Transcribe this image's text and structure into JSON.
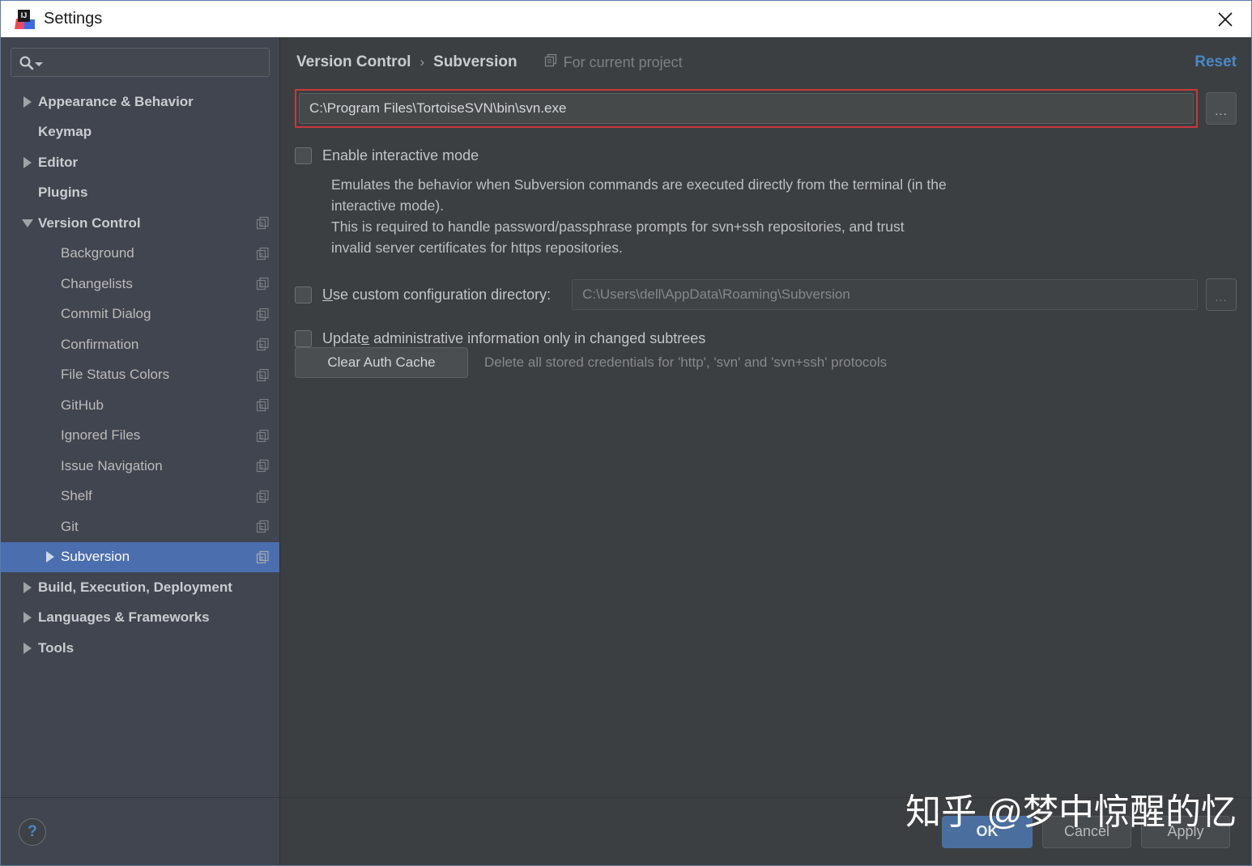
{
  "titlebar": {
    "title": "Settings",
    "app_icon": "intellij-idea-icon",
    "close_icon": "close-icon"
  },
  "sidebar": {
    "search": {
      "placeholder": "",
      "value": "",
      "icon": "search-icon",
      "caret_icon": "chevron-down-icon"
    },
    "help_label": "?",
    "items": [
      {
        "label": "Appearance & Behavior",
        "level": 0,
        "twisty": "right",
        "project_icon": false,
        "selected": false
      },
      {
        "label": "Keymap",
        "level": 0,
        "twisty": "none",
        "project_icon": false,
        "selected": false
      },
      {
        "label": "Editor",
        "level": 0,
        "twisty": "right",
        "project_icon": false,
        "selected": false
      },
      {
        "label": "Plugins",
        "level": 0,
        "twisty": "none",
        "project_icon": false,
        "selected": false
      },
      {
        "label": "Version Control",
        "level": 0,
        "twisty": "down",
        "project_icon": true,
        "selected": false
      },
      {
        "label": "Background",
        "level": 1,
        "twisty": "none",
        "project_icon": true,
        "selected": false
      },
      {
        "label": "Changelists",
        "level": 1,
        "twisty": "none",
        "project_icon": true,
        "selected": false
      },
      {
        "label": "Commit Dialog",
        "level": 1,
        "twisty": "none",
        "project_icon": true,
        "selected": false
      },
      {
        "label": "Confirmation",
        "level": 1,
        "twisty": "none",
        "project_icon": true,
        "selected": false
      },
      {
        "label": "File Status Colors",
        "level": 1,
        "twisty": "none",
        "project_icon": true,
        "selected": false
      },
      {
        "label": "GitHub",
        "level": 1,
        "twisty": "none",
        "project_icon": true,
        "selected": false
      },
      {
        "label": "Ignored Files",
        "level": 1,
        "twisty": "none",
        "project_icon": true,
        "selected": false
      },
      {
        "label": "Issue Navigation",
        "level": 1,
        "twisty": "none",
        "project_icon": true,
        "selected": false
      },
      {
        "label": "Shelf",
        "level": 1,
        "twisty": "none",
        "project_icon": true,
        "selected": false
      },
      {
        "label": "Git",
        "level": 1,
        "twisty": "none",
        "project_icon": true,
        "selected": false
      },
      {
        "label": "Subversion",
        "level": 1,
        "twisty": "right",
        "project_icon": true,
        "selected": true
      },
      {
        "label": "Build, Execution, Deployment",
        "level": 0,
        "twisty": "right",
        "project_icon": false,
        "selected": false
      },
      {
        "label": "Languages & Frameworks",
        "level": 0,
        "twisty": "right",
        "project_icon": false,
        "selected": false
      },
      {
        "label": "Tools",
        "level": 0,
        "twisty": "right",
        "project_icon": false,
        "selected": false
      }
    ]
  },
  "main": {
    "breadcrumb": {
      "root": "Version Control",
      "separator": "›",
      "leaf": "Subversion"
    },
    "scope": {
      "label": "For current project",
      "icon": "project-scope-icon"
    },
    "reset_label": "Reset",
    "svn_path": {
      "value": "C:\\Program Files\\TortoiseSVN\\bin\\svn.exe",
      "placeholder": "",
      "browse_label": "...",
      "annotation_color": "#c8393d"
    },
    "interactive": {
      "label": "Enable interactive mode",
      "checked": false,
      "description": "Emulates the behavior when Subversion commands are executed directly from the terminal (in the interactive mode).\nThis is required to handle password/passphrase prompts for svn+ssh repositories, and trust invalid server certificates for https repositories."
    },
    "custom_config": {
      "label_prefix": "",
      "mnemonic": "U",
      "label_rest": "se custom configuration directory:",
      "checked": false,
      "value": "C:\\Users\\dell\\AppData\\Roaming\\Subversion",
      "browse_label": "...",
      "disabled": true
    },
    "update_admin": {
      "label_prefix": "Updat",
      "mnemonic": "e",
      "label_rest": " administrative information only in changed subtrees",
      "checked": false
    },
    "auth": {
      "button_label": "Clear Auth Cache",
      "note": "Delete all stored credentials for 'http', 'svn' and 'svn+ssh' protocols"
    }
  },
  "footer": {
    "ok_label": "OK",
    "cancel_label": "Cancel",
    "apply_label": "Apply"
  },
  "watermark": {
    "text": "知乎 @梦中惊醒的忆"
  },
  "colors": {
    "panel_bg": "#3c3f41",
    "sidebar_bg": "#41454f",
    "selection": "#4b6eaf",
    "link": "#4a88c7",
    "annotation_red": "#c8393d",
    "primary_button": "#4a6f9e"
  }
}
